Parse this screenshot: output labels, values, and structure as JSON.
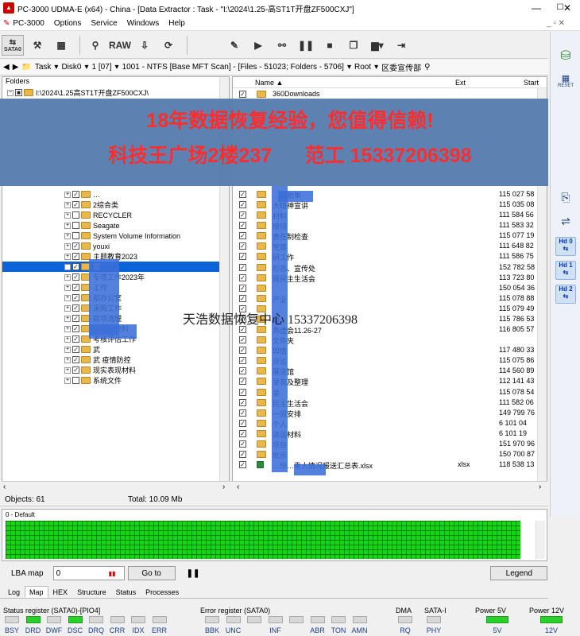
{
  "window": {
    "title": "PC-3000 UDMA-E (x64) - China - [Data Extractor : Task - \"I:\\2024\\1.25-高ST1T开盘ZF500CXJ\"]",
    "minimize": "—",
    "maximize": "☐",
    "close": "✕"
  },
  "menu": {
    "app": "PC-3000",
    "items": [
      "Options",
      "Service",
      "Windows",
      "Help"
    ],
    "mdi_controls": "_ ▫ ✕"
  },
  "toolbar": {
    "sata_label": "SATA0",
    "raw_label": "RAW"
  },
  "pathbar": {
    "task": "Task",
    "disk": "Disk0",
    "partition": "1 [07]",
    "volume": "1001 - NTFS [Base MFT Scan] - [Files - 51023; Folders - 5706]",
    "root": "Root",
    "current": "区委宣传部"
  },
  "right_strip": {
    "reset": "RESET",
    "hd0": "Hd 0",
    "hd1": "Hd 1",
    "hd2": "Hd 2"
  },
  "folders_panel": {
    "header": "Folders",
    "root_path": "I:\\2024\\1.25高ST1T开盘ZF500CXJ\\",
    "items": [
      {
        "label": "…",
        "checked": true
      },
      {
        "label": "2综合类",
        "checked": true
      },
      {
        "label": "RECYCLER",
        "checked": false
      },
      {
        "label": "Seagate",
        "checked": false
      },
      {
        "label": "System Volume Information",
        "checked": false
      },
      {
        "label": "youxi",
        "checked": true
      },
      {
        "label": "主题教育2023",
        "checked": true
      },
      {
        "label": "部",
        "checked": true,
        "selected": true
      },
      {
        "label": "专项工作2023年",
        "checked": true
      },
      {
        "label": "工作",
        "checked": true
      },
      {
        "label": "部办公室",
        "checked": true
      },
      {
        "label": "采购工作",
        "checked": true
      },
      {
        "label": "款项清理",
        "checked": true
      },
      {
        "label": "换电脑资料",
        "checked": true
      },
      {
        "label": "考核评估工作",
        "checked": true
      },
      {
        "label": "武",
        "checked": true
      },
      {
        "label": "武 疫情防控",
        "checked": true
      },
      {
        "label": "现实表现材料",
        "checked": true
      },
      {
        "label": "系统文件",
        "checked": false
      }
    ]
  },
  "files_panel": {
    "col_name": "Name ▲",
    "col_ext": "Ext",
    "col_start": "Start",
    "rows": [
      {
        "name": "360Downloads",
        "ext": "",
        "start": ""
      },
      {
        "name": "…据批单",
        "ext": "",
        "start": "115 027 58"
      },
      {
        "name": "大精神宣讲",
        "ext": "",
        "start": "115 035 08"
      },
      {
        "name": "材料",
        "ext": "",
        "start": "111 584 56"
      },
      {
        "name": "接待",
        "ext": "",
        "start": "111 583 32"
      },
      {
        "name": "责任制检查",
        "ext": "",
        "start": "115 077 19"
      },
      {
        "name": "党建",
        "ext": "",
        "start": "111 648 82"
      },
      {
        "name": "研工作",
        "ext": "",
        "start": "111 586 75"
      },
      {
        "name": "形态、宣传处",
        "ext": "",
        "start": "152 782 58"
      },
      {
        "name": "局民主生活会",
        "ext": "",
        "start": "113 723 80"
      },
      {
        "name": "",
        "ext": "",
        "start": "150 054 36"
      },
      {
        "name": "产业",
        "ext": "",
        "start": "115 078 88"
      },
      {
        "name": "",
        "ext": "",
        "start": "115 079 49"
      },
      {
        "name": "建",
        "ext": "",
        "start": "115 786 53"
      },
      {
        "name": "务虚会11.26-27",
        "ext": "",
        "start": "116 805 57"
      },
      {
        "name": "文件夹",
        "ext": "",
        "start": ""
      },
      {
        "name": "舆情",
        "ext": "",
        "start": "117 480 33"
      },
      {
        "name": "评论",
        "ext": "",
        "start": "115 075 86"
      },
      {
        "name": "展览馆",
        "ext": "",
        "start": "114 560 89"
      },
      {
        "name": "录音及整理",
        "ext": "",
        "start": "112 141 43"
      },
      {
        "name": "录",
        "ext": "",
        "start": "115 078 54"
      },
      {
        "name": "民主生活会",
        "ext": "",
        "start": "111 582 06"
      },
      {
        "name": "一周安排",
        "ext": "",
        "start": "149 799 76"
      },
      {
        "name": "个人",
        "ext": "",
        "start": "6 101 04"
      },
      {
        "name": "讲话材料",
        "ext": "",
        "start": "6 101 19"
      },
      {
        "name": "项目",
        "ext": "",
        "start": "151 970 96"
      },
      {
        "name": "批示",
        "ext": "",
        "start": "150 700 87"
      },
      {
        "name": "…份…重大情况报送汇总表.xlsx",
        "ext": "xlsx",
        "start": "118 538 13"
      }
    ]
  },
  "status": {
    "objects": "Objects: 61",
    "total": "Total: 10.09 Mb"
  },
  "map": {
    "label": "0 - Default",
    "lba_label": "LBA map",
    "lba_value": "0",
    "goto_label": "Go to",
    "pause_label": "❚❚",
    "legend_label": "Legend",
    "fill_fraction": 1.0
  },
  "bottom_tabs": [
    {
      "label": "Log",
      "active": false
    },
    {
      "label": "Map",
      "active": true
    },
    {
      "label": "HEX",
      "active": false
    },
    {
      "label": "Structure",
      "active": false
    },
    {
      "label": "Status",
      "active": false
    },
    {
      "label": "Processes",
      "active": false
    }
  ],
  "registers": {
    "status_title": "Status register (SATA0)-[PIO4]",
    "status_bits": [
      "BSY",
      "DRD",
      "DWF",
      "DSC",
      "DRQ",
      "CRR",
      "IDX",
      "ERR"
    ],
    "status_on": [
      false,
      true,
      false,
      true,
      false,
      false,
      false,
      false
    ],
    "error_title": "Error register (SATA0)",
    "error_bits": [
      "BBK",
      "UNC",
      "",
      "INF",
      "",
      "ABR",
      "TON",
      "AMN"
    ],
    "dma_title": "DMA",
    "dma_bit": "RQ",
    "sata_title": "SATA-I",
    "sata_bit": "PHY",
    "power5_title": "Power 5V",
    "power5_bit": "5V",
    "power12_title": "Power 12V",
    "power12_bit": "12V"
  },
  "overlay": {
    "banner_line1": "18年数据恢复经验，您值得信赖!",
    "banner_line2": "科技王广场2楼237      范工 15337206398",
    "watermark": "天浩数据恢复中心 15337206398"
  },
  "colors": {
    "banner": "#5a7fb0",
    "banner_text": "#ff2a2a",
    "map_green": "#1ad21a",
    "selection": "#0a64d8",
    "redaction": "#3c6fd8"
  }
}
